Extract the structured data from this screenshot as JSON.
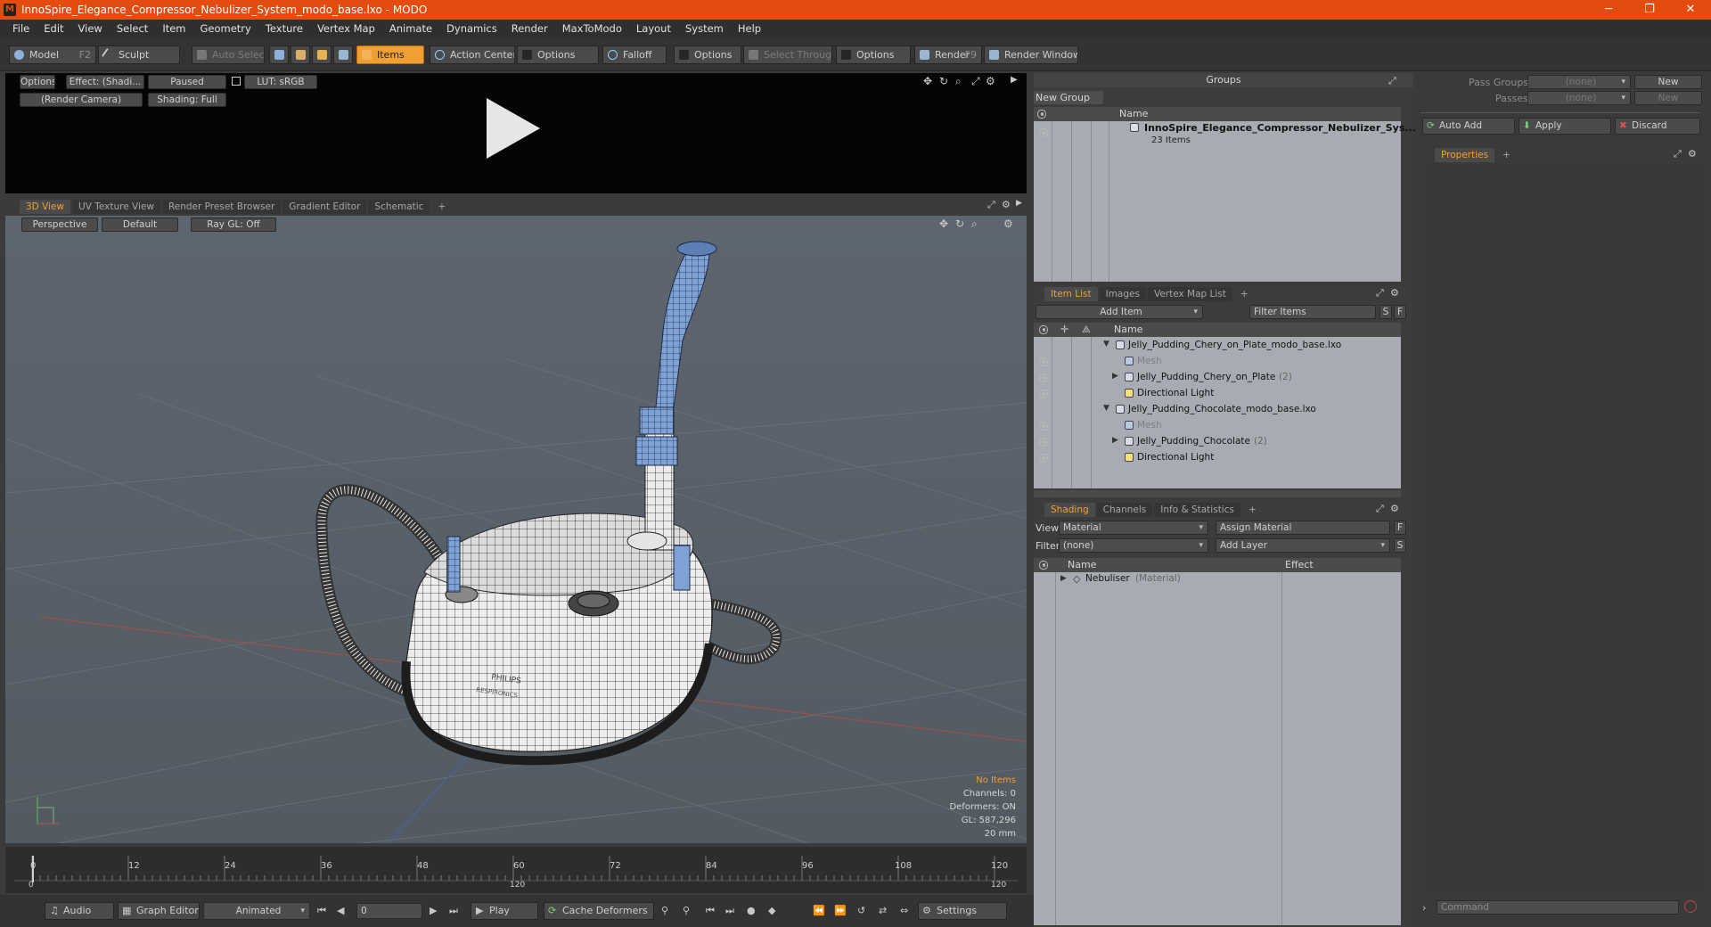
{
  "window": {
    "title": "InnoSpire_Elegance_Compressor_Nebulizer_System_modo_base.lxo - MODO",
    "min": "─",
    "max": "❐",
    "close": "✕"
  },
  "menu": [
    "File",
    "Edit",
    "View",
    "Select",
    "Item",
    "Geometry",
    "Texture",
    "Vertex Map",
    "Animate",
    "Dynamics",
    "Render",
    "MaxToModo",
    "Layout",
    "System",
    "Help"
  ],
  "toolbar": {
    "model": "Model",
    "model_key": "F2",
    "sculpt": "Sculpt",
    "auto_select": "Auto Select",
    "items": "Items",
    "action_center": "Action Center",
    "options1": "Options",
    "falloff": "Falloff",
    "options2": "Options",
    "select_through": "Select Through",
    "options3": "Options",
    "render": "Render",
    "render_key": "F9",
    "render_window": "Render Window"
  },
  "preview": {
    "options": "Options",
    "effect": "Effect: (Shadi...",
    "paused": "Paused",
    "lut": "LUT: sRGB",
    "camera": "(Render Camera)",
    "shading": "Shading: Full"
  },
  "viewport_tabs": [
    "3D View",
    "UV Texture View",
    "Render Preset Browser",
    "Gradient Editor",
    "Schematic",
    "+"
  ],
  "viewport": {
    "perspective": "Perspective",
    "default": "Default",
    "raygl": "Ray GL: Off",
    "brand1": "PHILIPS",
    "brand2": "RESPIRONICS",
    "info": {
      "no_items": "No Items",
      "channels": "Channels: 0",
      "deformers": "Deformers: ON",
      "gl": "GL: 587,296",
      "scale": "20 mm"
    }
  },
  "timeline": {
    "ticks": [
      "0",
      "12",
      "24",
      "36",
      "48",
      "60",
      "72",
      "84",
      "96",
      "108",
      "120"
    ],
    "sub_start": "0",
    "sub_mid": "120",
    "sub_end": "120"
  },
  "bottombar": {
    "audio": "Audio",
    "graph_editor": "Graph Editor",
    "animated": "Animated",
    "frame": "0",
    "play": "Play",
    "cache_deformers": "Cache Deformers",
    "settings": "Settings"
  },
  "groups": {
    "title": "Groups",
    "new_group": "New Group",
    "col_name": "Name",
    "item_name": "InnoSpire_Elegance_Compressor_Nebulizer_Sys...",
    "item_count": "23 Items"
  },
  "item_list": {
    "tabs": [
      "Item List",
      "Images",
      "Vertex Map List",
      "+"
    ],
    "add_item": "Add Item",
    "filter": "Filter Items",
    "s": "S",
    "f": "F",
    "col_name": "Name",
    "rows": [
      {
        "label": "Jelly_Pudding_Chery_on_Plate_modo_base.lxo",
        "extra": "",
        "indent": 0,
        "expand": "▼",
        "type": "scene",
        "dim": false
      },
      {
        "label": "Mesh",
        "extra": "",
        "indent": 1,
        "expand": "",
        "type": "mesh",
        "dim": true
      },
      {
        "label": "Jelly_Pudding_Chery_on_Plate",
        "extra": "(2)",
        "indent": 1,
        "expand": "▶",
        "type": "locator",
        "dim": false
      },
      {
        "label": "Directional Light",
        "extra": "",
        "indent": 1,
        "expand": "",
        "type": "light",
        "dim": false
      },
      {
        "label": "Jelly_Pudding_Chocolate_modo_base.lxo",
        "extra": "",
        "indent": 0,
        "expand": "▼",
        "type": "scene",
        "dim": false
      },
      {
        "label": "Mesh",
        "extra": "",
        "indent": 1,
        "expand": "",
        "type": "mesh",
        "dim": true
      },
      {
        "label": "Jelly_Pudding_Chocolate",
        "extra": "(2)",
        "indent": 1,
        "expand": "▶",
        "type": "locator",
        "dim": false
      },
      {
        "label": "Directional Light",
        "extra": "",
        "indent": 1,
        "expand": "",
        "type": "light",
        "dim": false
      }
    ]
  },
  "shading": {
    "tabs": [
      "Shading",
      "Channels",
      "Info & Statistics",
      "+"
    ],
    "view_label": "View",
    "view_value": "Material",
    "assign": "Assign Material",
    "f": "F",
    "filter_label": "Filter",
    "filter_value": "(none)",
    "add_layer": "Add Layer",
    "s": "S",
    "col_name": "Name",
    "col_effect": "Effect",
    "item": "Nebuliser",
    "item_type": "(Material)"
  },
  "right": {
    "pass_groups": "Pass Groups",
    "passes": "Passes",
    "none1": "(none)",
    "none2": "(none)",
    "new1": "New",
    "new2": "New",
    "auto_add": "Auto Add",
    "apply": "Apply",
    "discard": "Discard",
    "properties": "Properties",
    "plus": "+",
    "command": "Command"
  }
}
